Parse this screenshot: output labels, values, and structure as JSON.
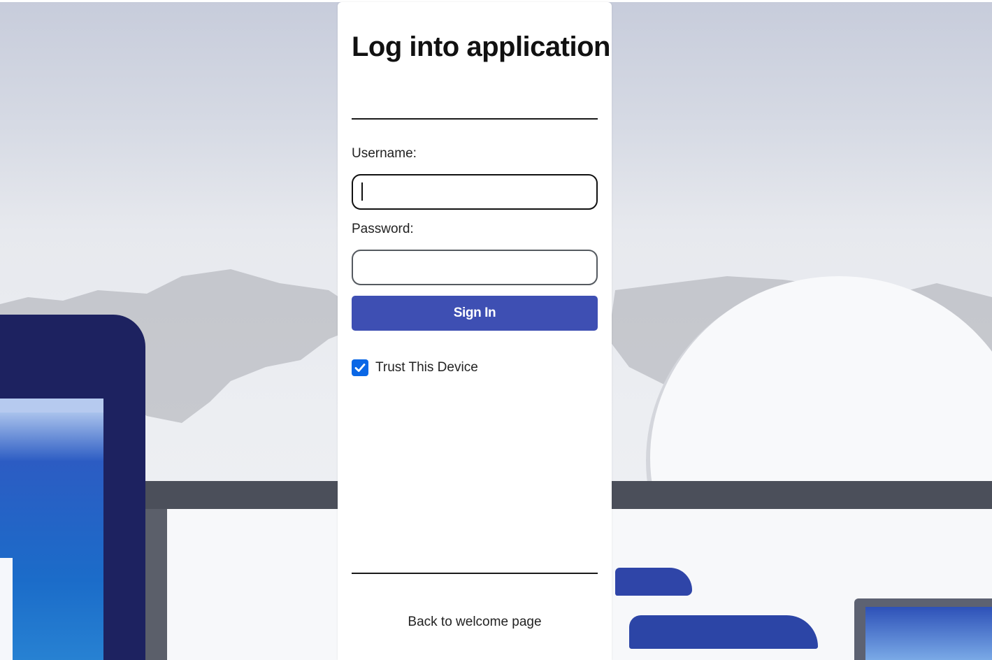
{
  "login": {
    "title": "Log into application",
    "username_label": "Username:",
    "username_value": "",
    "password_label": "Password:",
    "password_value": "",
    "sign_in_label": "Sign In",
    "trust_device_label": "Trust This Device",
    "trust_device_checked": true,
    "back_link": "Back to welcome page"
  },
  "colors": {
    "primary_button": "#3e4fb3",
    "checkbox_accent": "#0a67e6",
    "card_background": "#ffffff"
  },
  "icons": {
    "checkbox": "checkmark-icon"
  }
}
